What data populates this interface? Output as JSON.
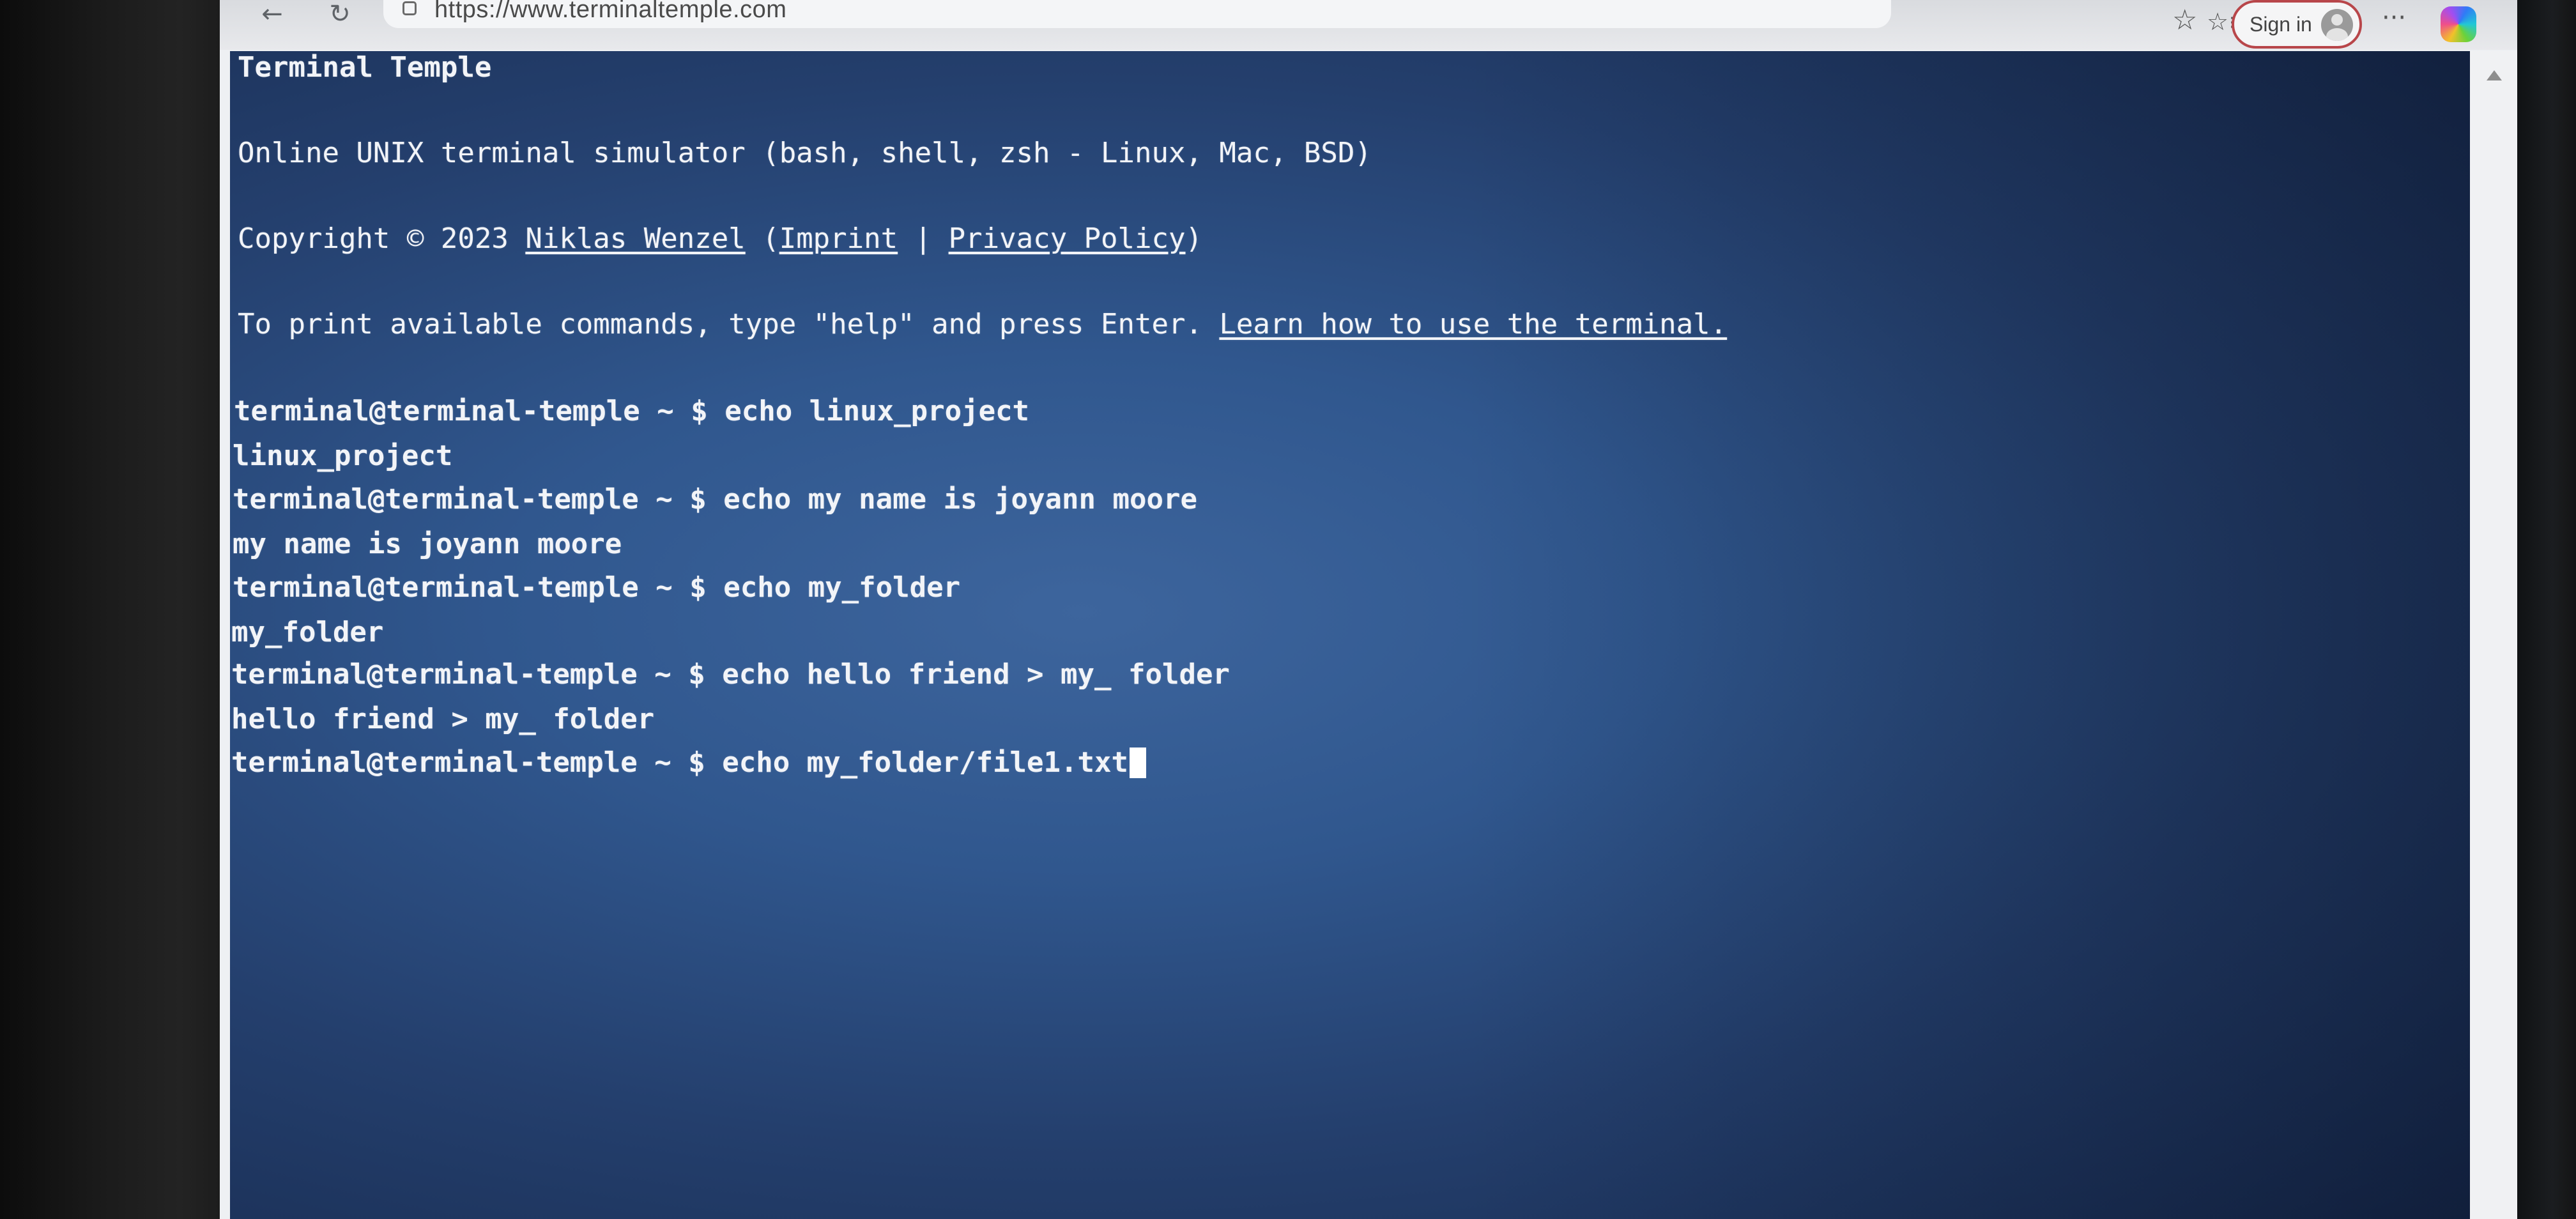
{
  "browser": {
    "back_glyph": "←",
    "refresh_glyph": "↻",
    "url": "https://www.terminaltemple.com",
    "favorite_glyph": "☆",
    "favorites_list_glyph": "☆≡",
    "sign_in_label": "Sign in",
    "more_glyph": "···"
  },
  "terminal": {
    "title": "Terminal Temple",
    "subtitle": "Online UNIX terminal simulator (bash, shell, zsh - Linux, Mac, BSD)",
    "copyright_prefix": "Copyright © 2023 ",
    "author_link": "Niklas Wenzel",
    "paren_open": " (",
    "imprint_link": "Imprint",
    "separator": " | ",
    "privacy_link": "Privacy Policy",
    "paren_close": ")",
    "help_text": "To print available commands, type \"help\" and press Enter. ",
    "learn_link": "Learn how to use the terminal.",
    "history": [
      {
        "prompt": "terminal@terminal-temple ~ $ ",
        "command": "echo linux_project",
        "output": "linux_project"
      },
      {
        "prompt": "terminal@terminal-temple ~ $ ",
        "command": "echo my name is joyann moore",
        "output": "my name is joyann moore"
      },
      {
        "prompt": "terminal@terminal-temple ~ $ ",
        "command": "echo my_folder",
        "output": "my_folder"
      },
      {
        "prompt": "terminal@terminal-temple ~ $ ",
        "command": "echo hello friend > my_ folder",
        "output": "hello friend > my_ folder"
      }
    ],
    "current": {
      "prompt": "terminal@terminal-temple ~ $ ",
      "input": "echo my_folder/file1.txt"
    }
  },
  "colors": {
    "terminal_bg": "#30578e",
    "terminal_text": "#f2f4f8",
    "signin_border": "#b8464a"
  },
  "icons": [
    "back-arrow-icon",
    "refresh-icon",
    "lock-icon",
    "favorite-star-icon",
    "favorites-list-icon",
    "avatar-icon",
    "more-icon",
    "copilot-icon"
  ]
}
